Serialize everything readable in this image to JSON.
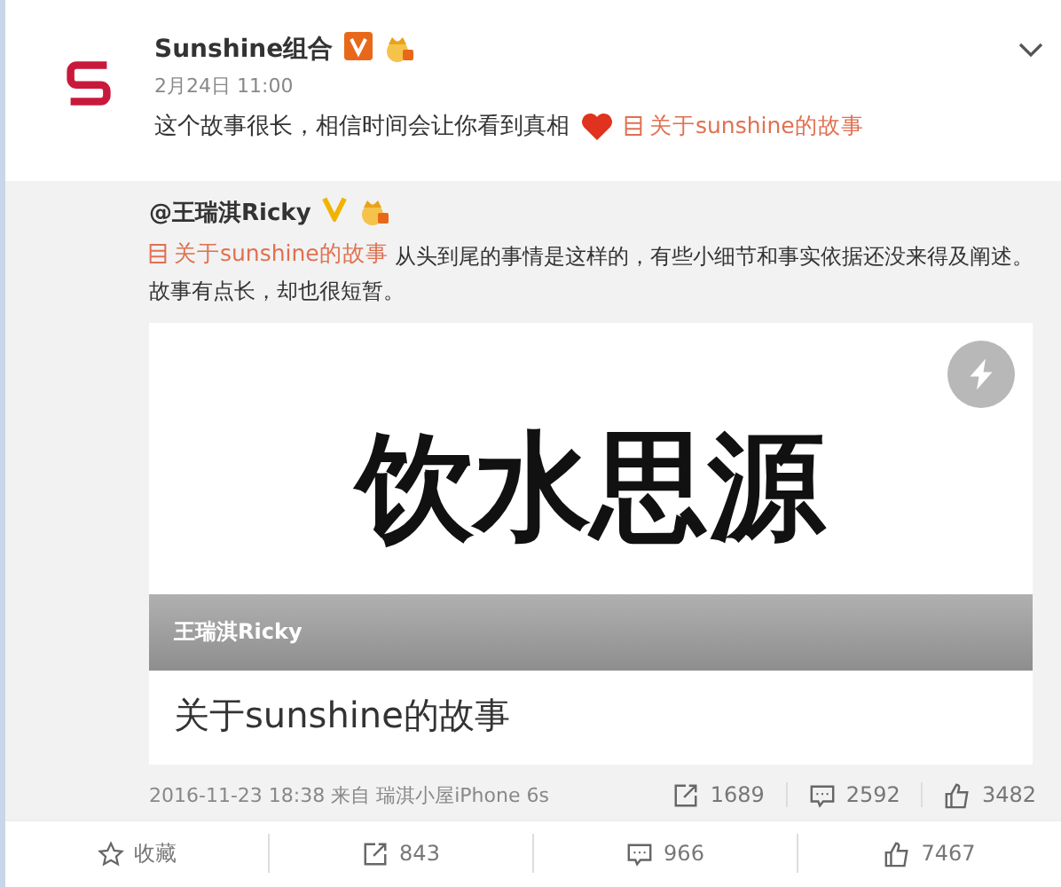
{
  "post": {
    "author": "Sunshine组合",
    "verified": true,
    "time": "2月24日 11:00",
    "text": "这个故事很长，相信时间会让你看到真相",
    "link": "关于sunshine的故事"
  },
  "repost": {
    "author": "@王瑞淇Ricky",
    "verified": true,
    "link": "关于sunshine的故事",
    "text": "从头到尾的事情是这样的，有些小细节和事实依据还没来得及阐述。故事有点长，却也很短暂。",
    "card": {
      "cover_text": "饮水思源",
      "byline": "王瑞淇Ricky",
      "title": "关于sunshine的故事"
    },
    "meta": "2016-11-23 18:38 来自 瑞淇小屋iPhone 6s",
    "stats": [
      {
        "kind": "repost",
        "count": "1689"
      },
      {
        "kind": "comment",
        "count": "2592"
      },
      {
        "kind": "like",
        "count": "3482"
      }
    ]
  },
  "actions": [
    {
      "kind": "favorite",
      "label": "收藏"
    },
    {
      "kind": "repost",
      "label": "843"
    },
    {
      "kind": "comment",
      "label": "966"
    },
    {
      "kind": "like",
      "label": "7467"
    }
  ]
}
